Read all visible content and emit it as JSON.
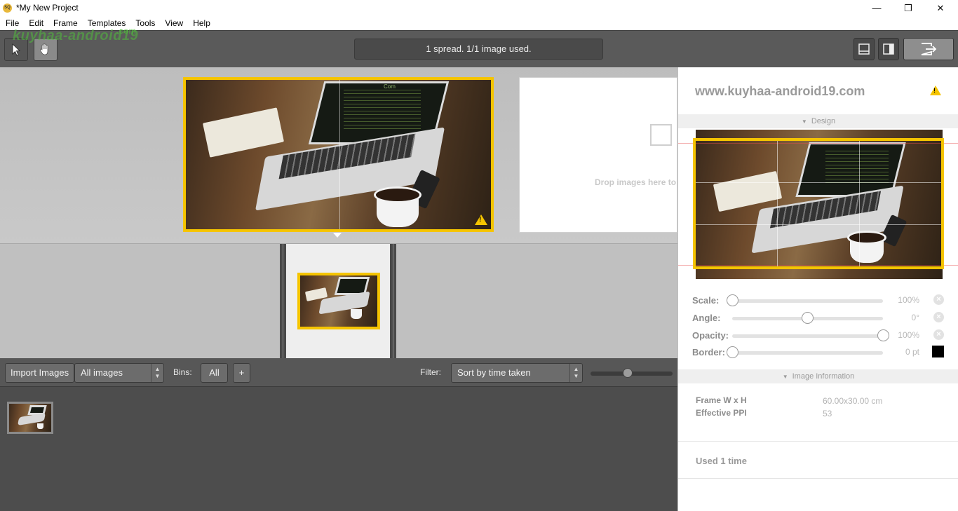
{
  "window": {
    "icon_label": "SQ",
    "title": "*My New Project",
    "minimize": "—",
    "restore": "❐",
    "close": "✕"
  },
  "menu": [
    "File",
    "Edit",
    "Frame",
    "Templates",
    "Tools",
    "View",
    "Help"
  ],
  "watermark": {
    "top": "kuyhaa-android19",
    "top_small": ".com",
    "panel": "www.kuyhaa-android19.com",
    "photo_screen": "Com"
  },
  "toolbar": {
    "status": "1 spread. 1/1 image used."
  },
  "canvas": {
    "warning_glyph": "!",
    "drop_text": "Drop images here to"
  },
  "bin_bar": {
    "import_label": "Import Images",
    "collection_select": "All images",
    "bins_label": "Bins:",
    "bins_all": "All",
    "bins_add": "+",
    "filter_label": "Filter:",
    "filter_select": "Sort by time taken",
    "zoom_level": 0.45
  },
  "panel": {
    "warning_glyph": "!",
    "design_header": "Design",
    "sliders": [
      {
        "label": "Scale:",
        "value": "100%",
        "position": 0.0
      },
      {
        "label": "Angle:",
        "value": "0°",
        "position": 0.5
      },
      {
        "label": "Opacity:",
        "value": "100%",
        "position": 1.0
      },
      {
        "label": "Border:",
        "value": "0 pt",
        "position": 0.0
      }
    ],
    "reset_glyph": "×",
    "border_color": "#000000",
    "info_header": "Image Information",
    "info": [
      {
        "label": "Frame W x H",
        "value": "60.00x30.00 cm"
      },
      {
        "label": "Effective PPI",
        "value": "53"
      }
    ],
    "used": "Used 1 time"
  },
  "colors": {
    "accent_yellow": "#f5c400",
    "toolbar_gray": "#5a5a5a"
  }
}
